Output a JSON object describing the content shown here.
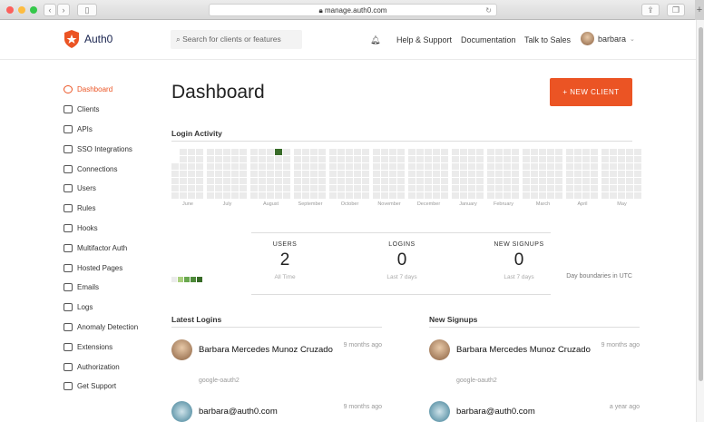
{
  "browser": {
    "url": "manage.auth0.com"
  },
  "header": {
    "brand": "Auth0",
    "search_placeholder": "Search for clients or features",
    "nav": [
      "Help & Support",
      "Documentation",
      "Talk to Sales"
    ],
    "user": "barbara"
  },
  "sidebar": {
    "items": [
      {
        "label": "Dashboard",
        "active": true
      },
      {
        "label": "Clients"
      },
      {
        "label": "APIs"
      },
      {
        "label": "SSO Integrations"
      },
      {
        "label": "Connections"
      },
      {
        "label": "Users"
      },
      {
        "label": "Rules"
      },
      {
        "label": "Hooks"
      },
      {
        "label": "Multifactor Auth"
      },
      {
        "label": "Hosted Pages"
      },
      {
        "label": "Emails"
      },
      {
        "label": "Logs"
      },
      {
        "label": "Anomaly Detection"
      },
      {
        "label": "Extensions"
      },
      {
        "label": "Authorization"
      },
      {
        "label": "Get Support"
      }
    ]
  },
  "main": {
    "title": "Dashboard",
    "new_client": "+ NEW CLIENT",
    "login_activity": {
      "title": "Login Activity",
      "note": "Day boundaries in UTC",
      "months": [
        {
          "name": "June",
          "weeks": 4
        },
        {
          "name": "July",
          "weeks": 5
        },
        {
          "name": "August",
          "weeks": 5
        },
        {
          "name": "September",
          "weeks": 4
        },
        {
          "name": "October",
          "weeks": 5
        },
        {
          "name": "November",
          "weeks": 4
        },
        {
          "name": "December",
          "weeks": 5
        },
        {
          "name": "January",
          "weeks": 4
        },
        {
          "name": "February",
          "weeks": 4
        },
        {
          "name": "March",
          "weeks": 5
        },
        {
          "name": "April",
          "weeks": 4
        },
        {
          "name": "May",
          "weeks": 5
        }
      ],
      "active_days": [
        {
          "month": "August",
          "week": 3,
          "day": 0,
          "level": 4
        }
      ],
      "legend_colors": [
        "#ebebeb",
        "#a9cf7d",
        "#6aa84f",
        "#4e8a3a",
        "#386b28"
      ]
    },
    "stats": [
      {
        "label": "USERS",
        "value": "2",
        "sub": "All Time"
      },
      {
        "label": "LOGINS",
        "value": "0",
        "sub": "Last 7 days"
      },
      {
        "label": "NEW SIGNUPS",
        "value": "0",
        "sub": "Last 7 days"
      }
    ],
    "latest_logins": {
      "title": "Latest Logins",
      "items": [
        {
          "name": "Barbara Mercedes Munoz Cruzado",
          "time": "9 months ago",
          "connection": "google-oauth2"
        },
        {
          "name": "barbara@auth0.com",
          "time": "9 months ago"
        }
      ]
    },
    "new_signups": {
      "title": "New Signups",
      "items": [
        {
          "name": "Barbara Mercedes Munoz Cruzado",
          "time": "9 months ago",
          "connection": "google-oauth2"
        },
        {
          "name": "barbara@auth0.com",
          "time": "a year ago"
        }
      ]
    }
  },
  "colors": {
    "accent": "#eb5424"
  }
}
